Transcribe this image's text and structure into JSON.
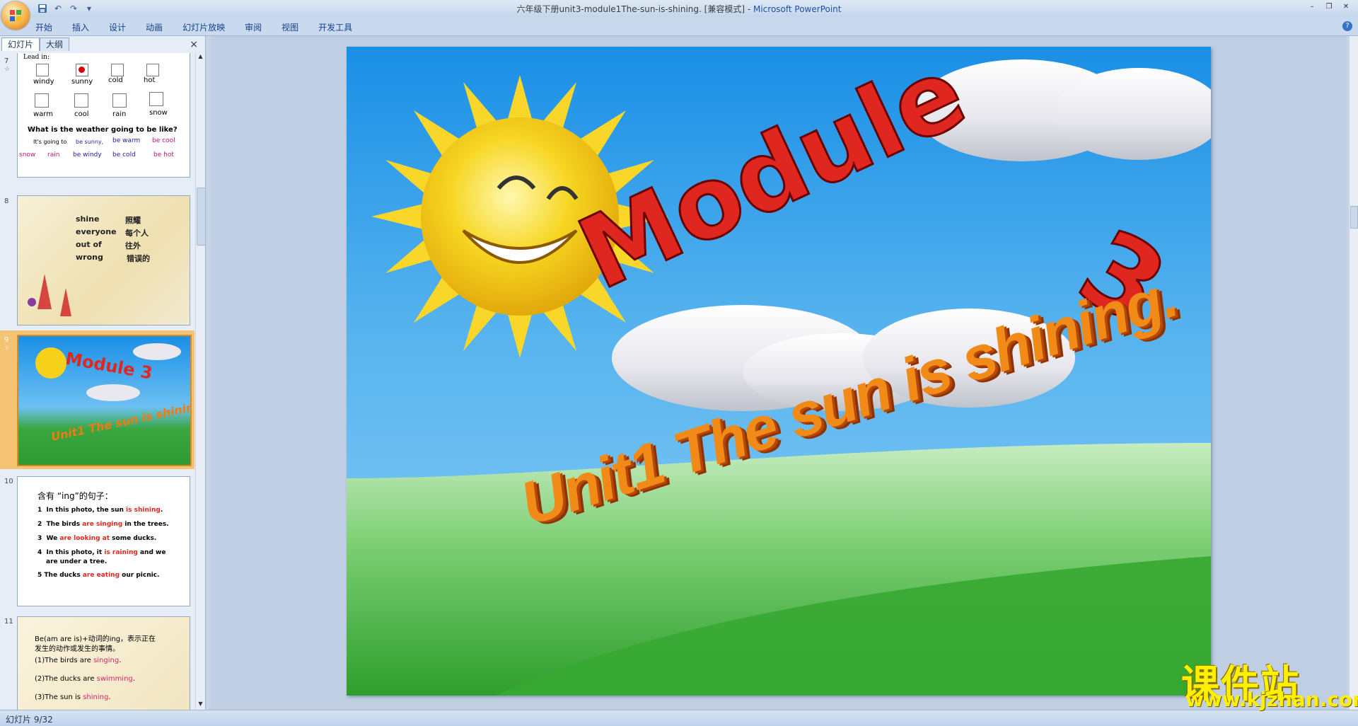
{
  "titlebar": {
    "title": "六年级下册unit3-module1The-sun-is-shining. [兼容模式] - ",
    "app": "Microsoft PowerPoint"
  },
  "ribbon": {
    "tabs": [
      "开始",
      "插入",
      "设计",
      "动画",
      "幻灯片放映",
      "审阅",
      "视图",
      "开发工具"
    ]
  },
  "left_pane": {
    "tabs": [
      "幻灯片",
      "大纲"
    ],
    "close": "×",
    "slides": [
      {
        "num": "7",
        "lead": "Lead in:",
        "weather": [
          "windy",
          "sunny",
          "cold",
          "hot",
          "warm",
          "cool",
          "rain",
          "snow"
        ],
        "question": "What is the weather going to be like?",
        "line1": [
          "It's going to",
          "be sunny,",
          "be warm",
          "be cool"
        ],
        "line2": [
          "snow",
          "rain",
          "be windy",
          "be cold",
          "be hot"
        ]
      },
      {
        "num": "8",
        "words": [
          [
            "shine",
            "照耀"
          ],
          [
            "everyone",
            "每个人"
          ],
          [
            "out of",
            "往外"
          ],
          [
            "wrong",
            "错误的"
          ]
        ]
      },
      {
        "num": "9",
        "t1": "Module 3",
        "t2": "Unit1 The sun is shining."
      },
      {
        "num": "10",
        "head": "含有 “ing”的句子：",
        "sentences": [
          [
            "1",
            "In this photo, the sun ",
            "is shining",
            "."
          ],
          [
            "2",
            "The birds ",
            "are singing",
            " in the trees."
          ],
          [
            "3",
            "We ",
            "are looking at",
            " some ducks."
          ],
          [
            "4",
            "In this photo, it ",
            "is raining",
            " and we"
          ],
          [
            "",
            "are under a tree.",
            "",
            ""
          ],
          [
            "5",
            "The ducks ",
            "are eating",
            " our picnic."
          ]
        ]
      },
      {
        "num": "11",
        "head1": "Be(am are is)+动词的ing，表示正在",
        "head2": "发生的动作或发生的事情。",
        "items": [
          [
            "(1)The birds are ",
            "singing",
            "."
          ],
          [
            "(2)The ducks are ",
            "swimming",
            "."
          ],
          [
            "(3)The sun is ",
            "shining",
            "."
          ]
        ]
      }
    ]
  },
  "slide": {
    "title1": "Module",
    "title2": "3",
    "subtitle": "Unit1 The sun is shining."
  },
  "status": {
    "text": "幻灯片 9/32"
  },
  "watermark": {
    "cn": "课件站",
    "url": "www.kjzhan.com"
  },
  "colors": {
    "accent": "#e0271f",
    "selected": "#f4c374",
    "sky": "#1a8fe6"
  }
}
